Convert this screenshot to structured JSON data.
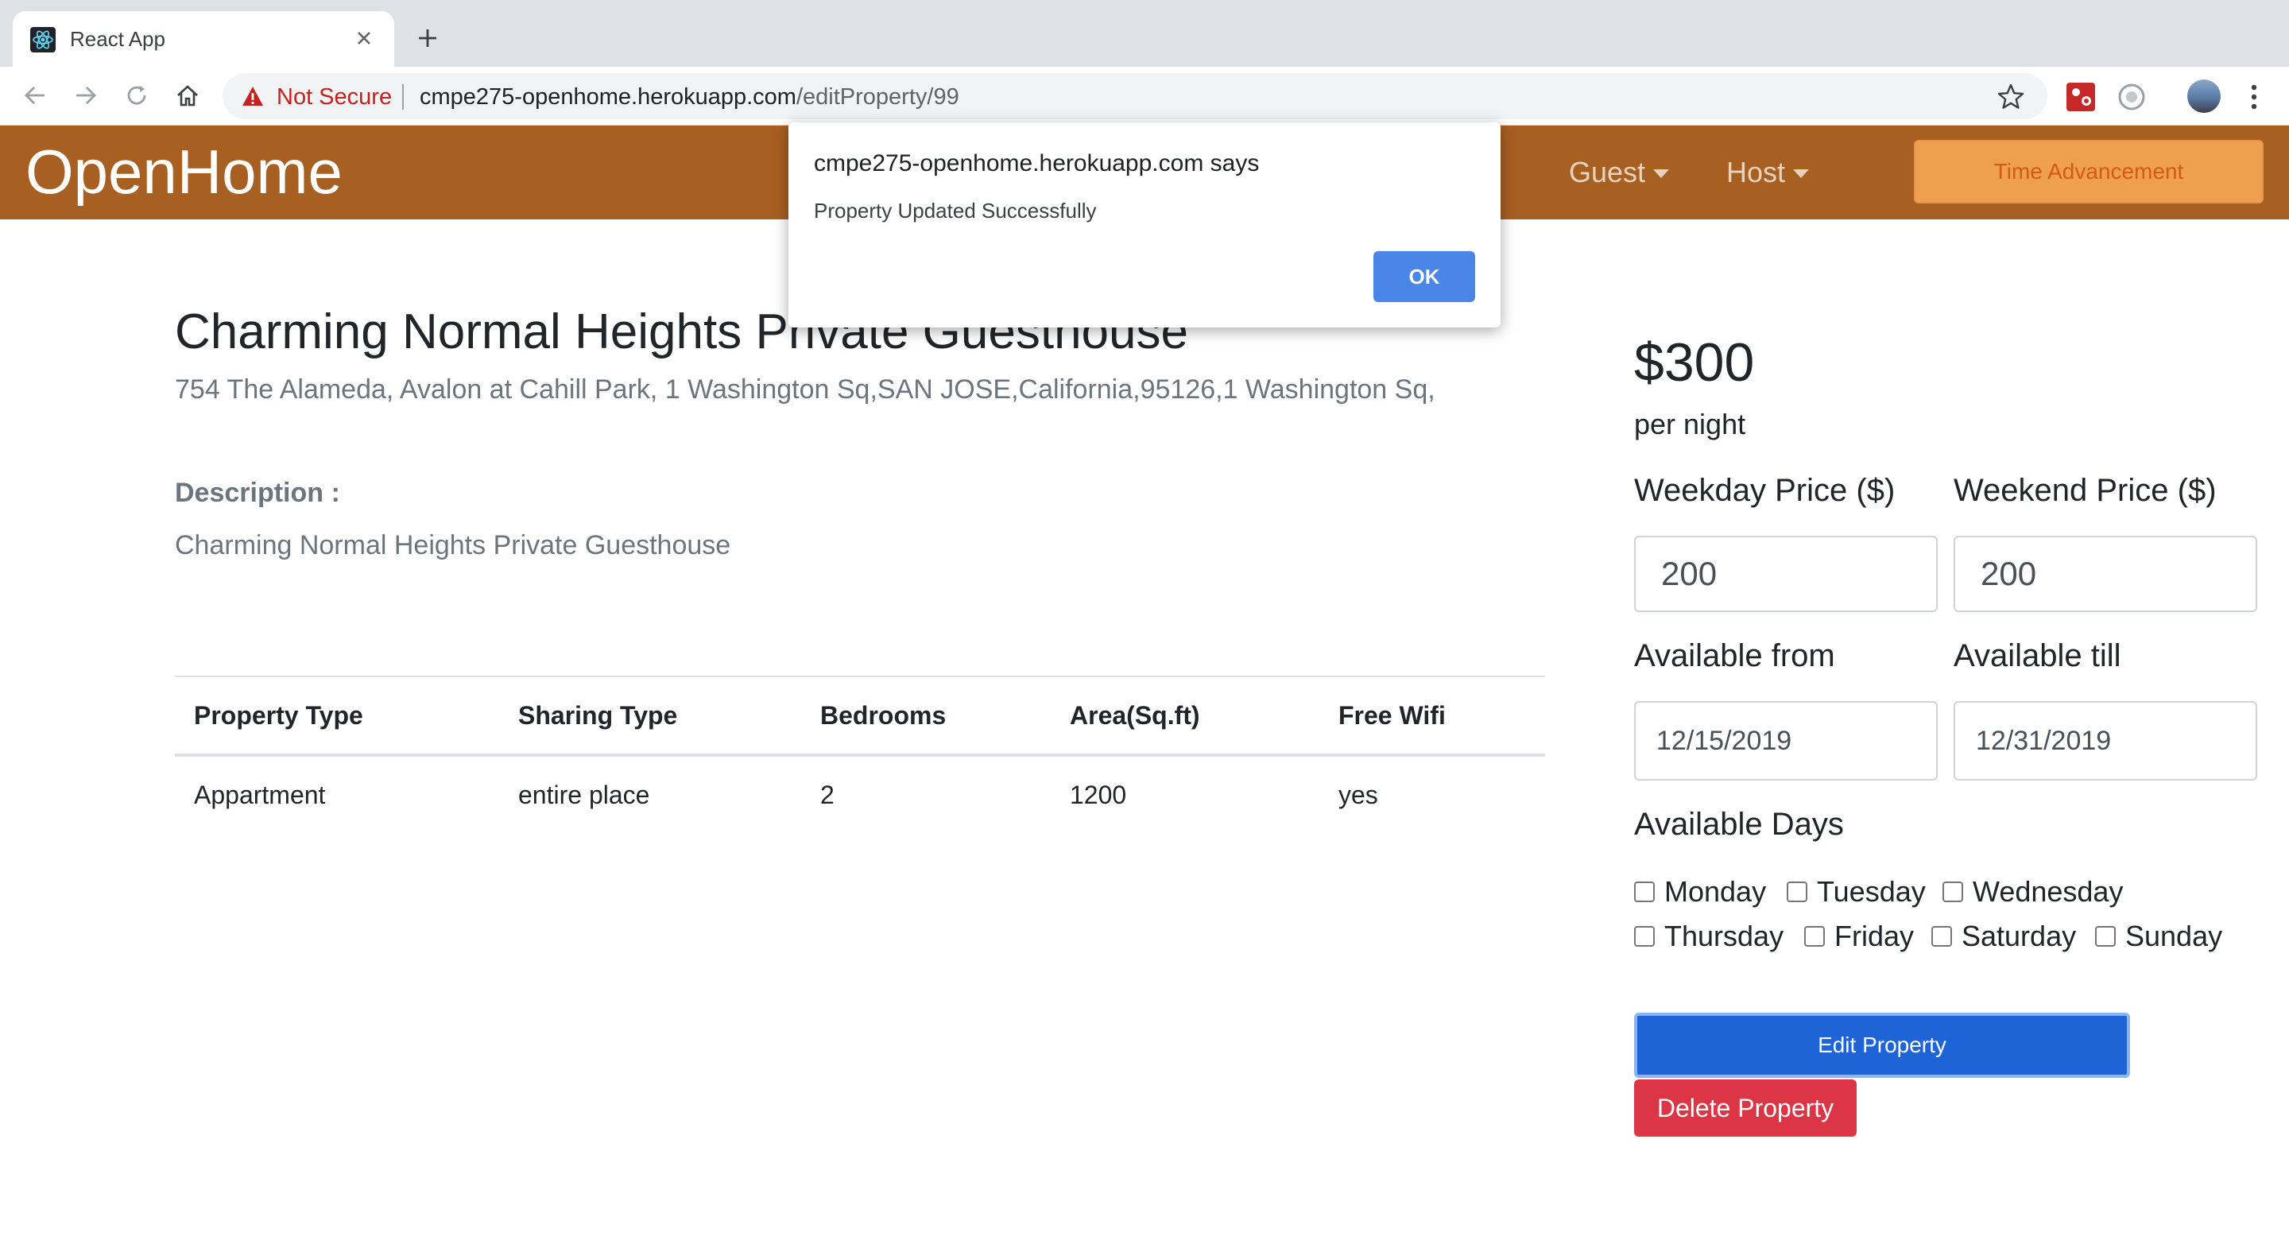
{
  "browser": {
    "tab_title": "React App",
    "security_label": "Not Secure",
    "url_host": "cmpe275-openhome.herokuapp.com",
    "url_path": "/editProperty/99"
  },
  "navbar": {
    "brand": "OpenHome",
    "guest_label": "Guest",
    "host_label": "Host",
    "time_button": "Time Advancement"
  },
  "property": {
    "title": "Charming Normal Heights Private Guesthouse",
    "address": "754 The Alameda, Avalon at Cahill Park, 1 Washington Sq,SAN JOSE,California,95126,1 Washington Sq,",
    "description_label": "Description :",
    "description": "Charming Normal Heights Private Guesthouse"
  },
  "details_table": {
    "headers": [
      "Property Type",
      "Sharing Type",
      "Bedrooms",
      "Area(Sq.ft)",
      "Free Wifi"
    ],
    "row": [
      "Appartment",
      "entire place",
      "2",
      "1200",
      "yes"
    ]
  },
  "pricing": {
    "price": "$300",
    "per_night": "per night",
    "weekday_label": "Weekday Price ($)",
    "weekend_label": "Weekend Price ($)",
    "weekday_value": "200",
    "weekend_value": "200",
    "from_label": "Available from",
    "till_label": "Available till",
    "from_value": "12/15/2019",
    "till_value": "12/31/2019",
    "days_label": "Available Days",
    "days": [
      "Monday",
      "Tuesday",
      "Wednesday",
      "Thursday",
      "Friday",
      "Saturday",
      "Sunday"
    ]
  },
  "actions": {
    "edit": "Edit Property",
    "delete": "Delete Property"
  },
  "dialog": {
    "title": "cmpe275-openhome.herokuapp.com says",
    "message": "Property Updated Successfully",
    "ok": "OK"
  },
  "colors": {
    "navbar": "#a85f22",
    "time_button": "#eea050",
    "edit_button": "#1f64d6",
    "delete_button": "#dc3545",
    "dialog_ok": "#4a86e8"
  }
}
